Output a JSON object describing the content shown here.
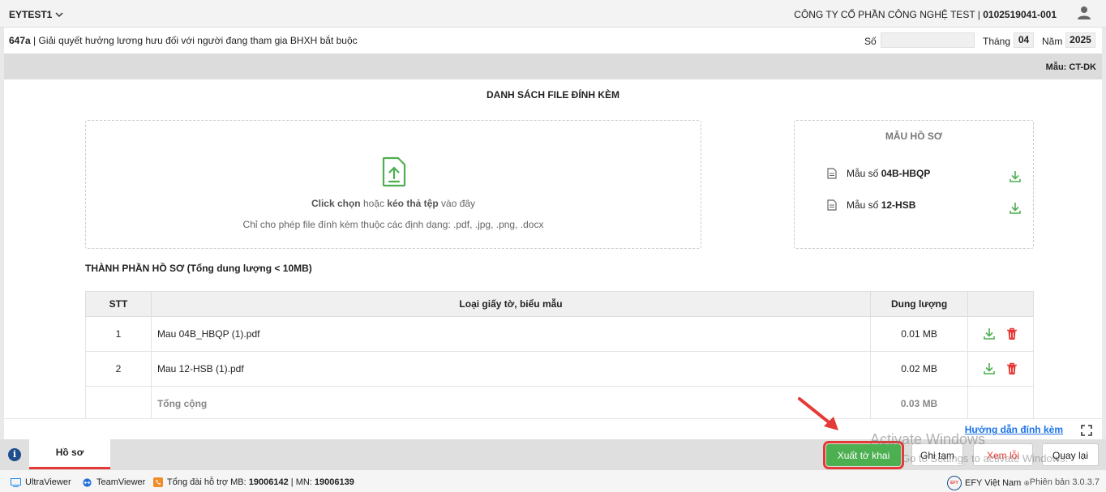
{
  "header": {
    "account": "EYTEST1",
    "company": "CÔNG TY CỔ PHẦN CÔNG NGHỆ TEST",
    "tax_code": "0102519041-001"
  },
  "form": {
    "code": "647a",
    "title": " | Giải quyết hưởng lương hưu đối với người đang tham gia BHXH bắt buộc",
    "so_label": "Số",
    "so_value": "",
    "thang_label": "Tháng",
    "thang_value": "04",
    "nam_label": "Năm",
    "nam_value": "2025",
    "mau_label": "Mẫu: CT-DK"
  },
  "attachments": {
    "heading": "DANH SÁCH FILE ĐÍNH KÈM",
    "drop_click": "Click chọn",
    "drop_or": " hoặc ",
    "drop_drag": "kéo thả tệp",
    "drop_here": " vào đây",
    "drop_formats": "Chỉ cho phép file đính kèm thuộc các định dạng: .pdf, .jpg, .png, .docx"
  },
  "templates": {
    "title": "MẪU HỒ SƠ",
    "items": [
      {
        "prefix": "Mẫu số ",
        "code": "04B-HBQP"
      },
      {
        "prefix": "Mẫu số ",
        "code": "12-HSB"
      }
    ]
  },
  "components": {
    "title": "THÀNH PHẦN HỒ SƠ (Tổng dung lượng < 10MB)",
    "columns": [
      "STT",
      "Loại giấy tờ, biểu mẫu",
      "Dung lượng"
    ],
    "rows": [
      {
        "stt": "1",
        "name": "Mau 04B_HBQP (1).pdf",
        "size": "0.01 MB"
      },
      {
        "stt": "2",
        "name": "Mau 12-HSB (1).pdf",
        "size": "0.02 MB"
      }
    ],
    "total_label": "Tổng cộng",
    "total_size": "0.03 MB"
  },
  "guide_link": "Hướng dẫn đính kèm",
  "footer": {
    "tab_label": "Hồ sơ",
    "btn_export": "Xuất tờ khai",
    "btn_draft": "Ghi tạm",
    "btn_errors": "Xem lỗi",
    "btn_back": "Quay lại"
  },
  "watermark": {
    "line1": "Activate Windows",
    "line2": "Go to Settings to activate Windows."
  },
  "statusbar": {
    "ultraviewer": "UltraViewer",
    "teamviewer": "TeamViewer",
    "support_prefix": "Tổng đài hỗ trợ MB: ",
    "support_mb": "19006142",
    "support_sep": " | MN: ",
    "support_mn": "19006139",
    "efy": "EFY Việt Nam",
    "efy_logo": "EFY",
    "version": "Phiên bản 3.0.3.7"
  },
  "colors": {
    "accent_green": "#4caf50",
    "danger_red": "#e53935",
    "link_blue": "#1a73e8"
  }
}
